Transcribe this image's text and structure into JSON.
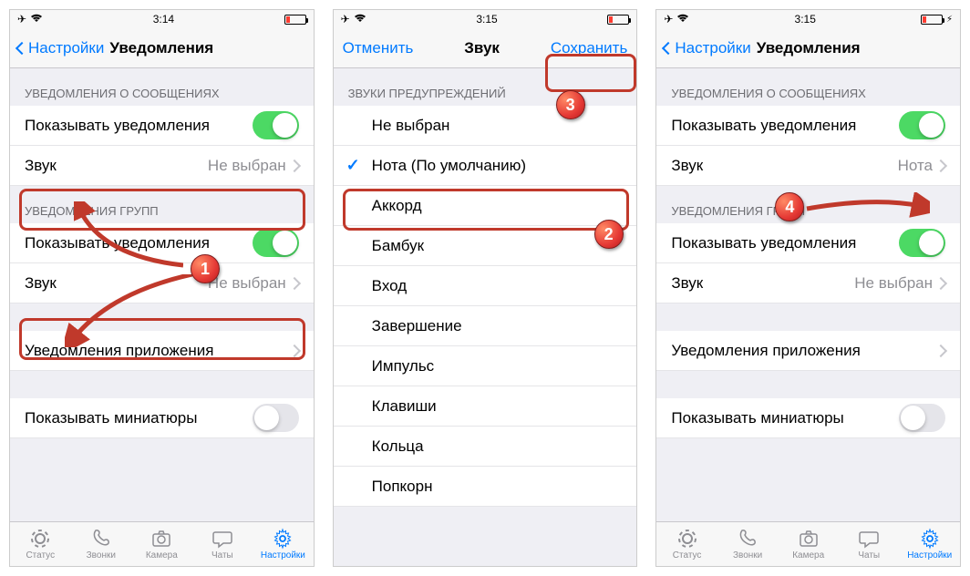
{
  "status": {
    "time1": "3:14",
    "time2": "3:15",
    "time3": "3:15"
  },
  "screen1": {
    "back": "Настройки",
    "title": "Уведомления",
    "sect_msg": "УВЕДОМЛЕНИЯ О СООБЩЕНИЯХ",
    "show_notif": "Показывать уведомления",
    "sound": "Звук",
    "sound_val": "Не выбран",
    "sect_group": "УВЕДОМЛЕНИЯ ГРУПП",
    "show_notif2": "Показывать уведомления",
    "sound2": "Звук",
    "sound2_val": "Не выбран",
    "app_notif": "Уведомления приложения",
    "show_thumb": "Показывать миниатюры"
  },
  "screen2": {
    "cancel": "Отменить",
    "title": "Звук",
    "save": "Сохранить",
    "sect": "ЗВУКИ ПРЕДУПРЕЖДЕНИЙ",
    "items": [
      "Не выбран",
      "Нота (По умолчанию)",
      "Аккорд",
      "Бамбук",
      "Вход",
      "Завершение",
      "Импульс",
      "Клавиши",
      "Кольца",
      "Попкорн"
    ],
    "selected_index": 1
  },
  "screen3": {
    "back": "Настройки",
    "title": "Уведомления",
    "sect_msg": "УВЕДОМЛЕНИЯ О СООБЩЕНИЯХ",
    "show_notif": "Показывать уведомления",
    "sound": "Звук",
    "sound_val": "Нота",
    "sect_group": "УВЕДОМЛЕНИЯ ГРУПП",
    "show_notif2": "Показывать уведомления",
    "sound2": "Звук",
    "sound2_val": "Не выбран",
    "app_notif": "Уведомления приложения",
    "show_thumb": "Показывать миниатюры"
  },
  "tabs": {
    "status": "Статус",
    "calls": "Звонки",
    "camera": "Камера",
    "chats": "Чаты",
    "settings": "Настройки"
  },
  "badges": {
    "b1": "1",
    "b2": "2",
    "b3": "3",
    "b4": "4"
  }
}
